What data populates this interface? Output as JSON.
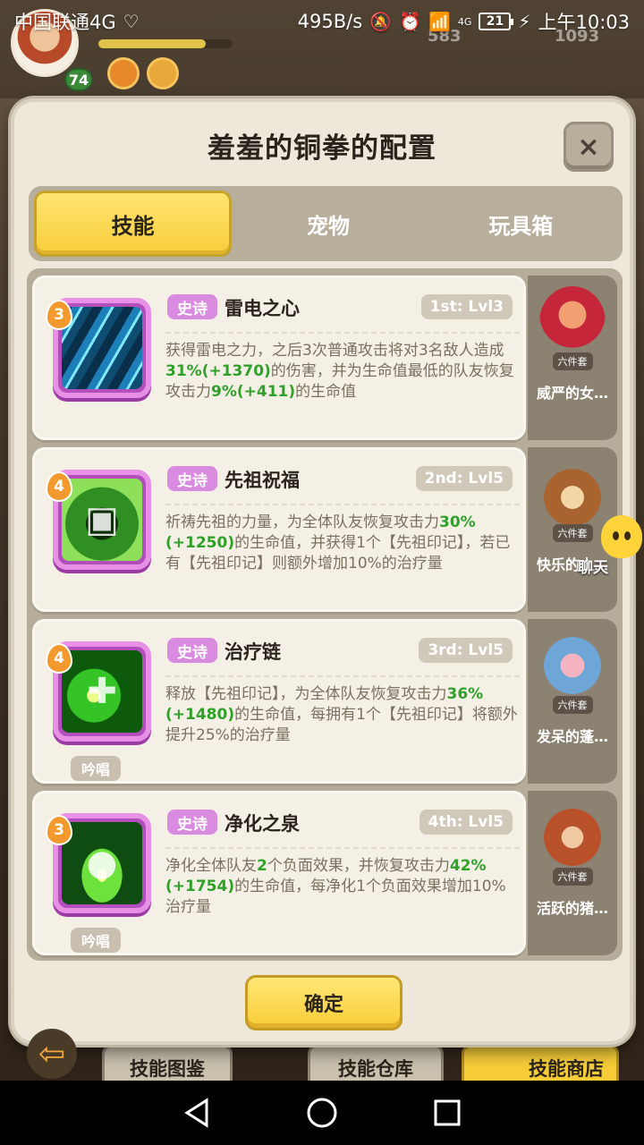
{
  "status_bar": {
    "carrier": "中国联通4G",
    "net_speed": "495B/s",
    "network": "4G",
    "battery": "21",
    "time": "上午10:03"
  },
  "background": {
    "player_level": "74",
    "currency_1": "583",
    "currency_2": "1093"
  },
  "dialog": {
    "title": "羞羞的铜拳的配置",
    "close_label": "×",
    "tabs": [
      {
        "label": "技能",
        "active": true
      },
      {
        "label": "宠物",
        "active": false
      },
      {
        "label": "玩具箱",
        "active": false
      }
    ],
    "confirm_label": "确定"
  },
  "skills": [
    {
      "rank": "3",
      "rarity": "史诗",
      "name": "雷电之心",
      "level": "1st: Lvl3",
      "icon": "lightning-art",
      "chant": "",
      "desc_parts": [
        {
          "t": "获得雷电之力，之后3次普通攻击将对3名敌人造成"
        },
        {
          "t": "31%(+1370)",
          "hl": true
        },
        {
          "t": "的伤害，并为生命值最低的队友恢复攻击力"
        },
        {
          "t": "9%(+411)",
          "hl": true
        },
        {
          "t": "的生命值"
        }
      ]
    },
    {
      "rank": "4",
      "rarity": "史诗",
      "name": "先祖祝福",
      "level": "2nd: Lvl5",
      "icon": "ancestor-art",
      "chant": "",
      "desc_parts": [
        {
          "t": "祈祷先祖的力量，为全体队友恢复攻击力"
        },
        {
          "t": "30%(+1250)",
          "hl": true
        },
        {
          "t": "的生命值，并获得1个【先祖印记】，若已有【先祖印记】则额外增加10%的治疗量"
        }
      ]
    },
    {
      "rank": "4",
      "rarity": "史诗",
      "name": "治疗链",
      "level": "3rd: Lvl5",
      "icon": "heal-chain-art",
      "chant": "吟唱",
      "desc_parts": [
        {
          "t": "释放【先祖印记】，为全体队友恢复攻击力"
        },
        {
          "t": "36%(+1480)",
          "hl": true
        },
        {
          "t": "的生命值，每拥有1个【先祖印记】将额外提升25%的治疗量"
        }
      ]
    },
    {
      "rank": "3",
      "rarity": "史诗",
      "name": "净化之泉",
      "level": "4th: Lvl5",
      "icon": "purify-spring-art",
      "chant": "吟唱",
      "desc_parts": [
        {
          "t": "净化全体队友"
        },
        {
          "t": "2",
          "hl": true
        },
        {
          "t": "个负面效果，并恢复攻击力"
        },
        {
          "t": "42%(+1754)",
          "hl": true
        },
        {
          "t": "的生命值，每净化1个负面效果增加10%治疗量"
        }
      ]
    }
  ],
  "pets": [
    {
      "name": "威严的女…",
      "set": "六件套"
    },
    {
      "name": "快乐的土…",
      "set": "六件套"
    },
    {
      "name": "发呆的蓬…",
      "set": "六件套"
    },
    {
      "name": "活跃的猪…",
      "set": "六件套"
    }
  ],
  "chat": {
    "label": "聊天"
  },
  "bottom_buttons": {
    "skill_codex": "技能图鉴",
    "skill_storage": "技能仓库",
    "skill_shop": "技能商店"
  },
  "colors": {
    "highlight": "#2fa12a",
    "epic": "#d98be0",
    "confirm": "#f7cd3a"
  }
}
